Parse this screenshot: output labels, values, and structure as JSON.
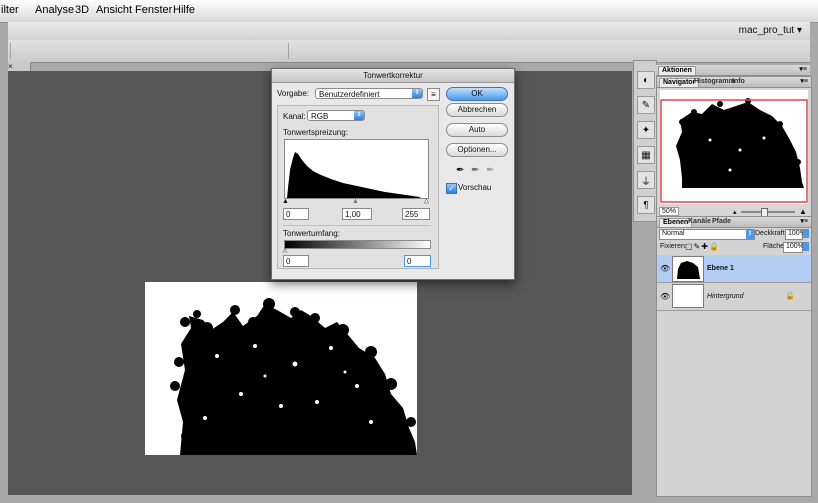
{
  "menubar": {
    "items": [
      "ilter",
      "Analyse",
      "3D",
      "Ansicht",
      "Fenster",
      "Hilfe"
    ]
  },
  "appbar": {
    "workspace": "mac_pro_tut ▾"
  },
  "doc_tab": {
    "label": "× "
  },
  "dialog": {
    "title": "Tonwertkorrektur",
    "preset_label": "Vorgabe:",
    "preset_value": "Benutzerdefiniert",
    "channel_label": "Kanal:",
    "channel_value": "RGB",
    "input_levels_label": "Tonwertspreizung:",
    "input_black": "0",
    "input_gamma": "1,00",
    "input_white": "255",
    "output_levels_label": "Tonwertumfang:",
    "output_black": "0",
    "output_white": "0",
    "ok_label": "OK",
    "cancel_label": "Abbrechen",
    "auto_label": "Auto",
    "options_label": "Optionen...",
    "preview_label": "Vorschau",
    "preview_checked": true
  },
  "panels": {
    "actions_tab": "Aktionen",
    "nav_tabs": [
      "Navigator",
      "Histogramm",
      "Info"
    ],
    "zoom": "50%",
    "layer_tabs": [
      "Ebenen",
      "Kanäle",
      "Pfade"
    ],
    "blend_mode": "Normal",
    "opacity_label": "Deckkraft:",
    "opacity_value": "100%",
    "lock_label": "Fixieren:",
    "fill_label": "Fläche:",
    "fill_value": "100%",
    "layers": [
      {
        "name": "Ebene 1",
        "selected": true
      },
      {
        "name": "Hintergrund",
        "selected": false
      }
    ]
  },
  "colors": {
    "accent": "#4f98e9",
    "selected_layer": "#b4cdf5",
    "nav_frame": "#e0474f"
  }
}
